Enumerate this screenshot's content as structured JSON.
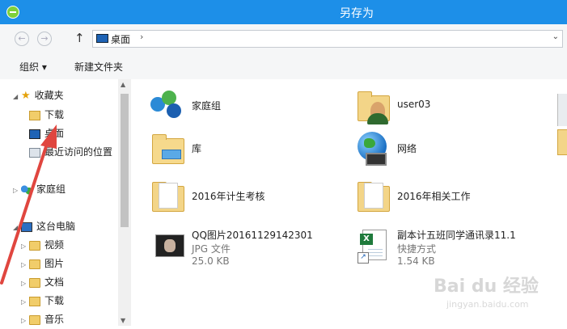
{
  "window": {
    "title": "另存为"
  },
  "nav": {
    "back": "←",
    "forward": "→",
    "up": "↑"
  },
  "address": {
    "location": "桌面",
    "separator": "›",
    "dropdown": "⌄"
  },
  "toolbar": {
    "organize": "组织 ▾",
    "new_folder": "新建文件夹"
  },
  "sidebar": {
    "favorites": "收藏夹",
    "fav_items": [
      "下载",
      "桌面",
      "最近访问的位置"
    ],
    "homegroup": "家庭组",
    "this_pc": "这台电脑",
    "pc_items": [
      "视频",
      "图片",
      "文档",
      "下载",
      "音乐"
    ]
  },
  "files": [
    {
      "name": "家庭组",
      "icon": "homegroup-icon"
    },
    {
      "name": "user03",
      "icon": "user-folder-icon"
    },
    {
      "name": "库",
      "icon": "libraries-icon"
    },
    {
      "name": "网络",
      "icon": "network-icon"
    },
    {
      "name": "2016年计生考核",
      "icon": "folder-icon"
    },
    {
      "name": "2016年相关工作",
      "icon": "folder-icon"
    },
    {
      "name": "QQ图片20161129142301",
      "type": "JPG 文件",
      "size": "25.0 KB",
      "icon": "jpg-icon"
    },
    {
      "name": "副本计五班同学通讯录11.1",
      "type": "快捷方式",
      "size": "1.54 KB",
      "icon": "excel-shortcut-icon"
    }
  ],
  "watermark": {
    "brand": "Bai du 经验",
    "url": "jingyan.baidu.com"
  },
  "colors": {
    "titlebar": "#1d8fe8",
    "annotation_arrow": "#e0463f"
  }
}
